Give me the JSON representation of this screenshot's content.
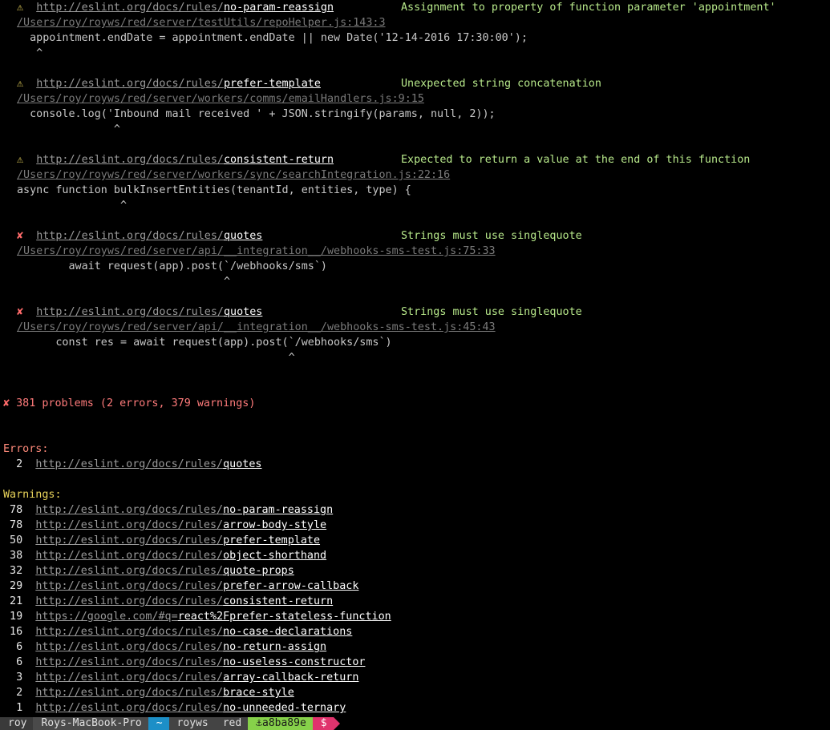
{
  "issues": [
    {
      "symbol": "⚠",
      "url_prefix": "http://eslint.org/docs/rules/",
      "rule": "no-param-reassign",
      "message": "Assignment to property of function parameter 'appointment'",
      "path": "/Users/roy/royws/red/server/testUtils/repoHelper.js:143:3",
      "code": "  appointment.endDate = appointment.endDate || new Date('12-14-2016 17:30:00');",
      "caret": "   ^"
    },
    {
      "symbol": "⚠",
      "url_prefix": "http://eslint.org/docs/rules/",
      "rule": "prefer-template",
      "message": "Unexpected string concatenation",
      "path": "/Users/roy/royws/red/server/workers/comms/emailHandlers.js:9:15",
      "code": "  console.log('Inbound mail received ' + JSON.stringify(params, null, 2));",
      "caret": "               ^"
    },
    {
      "symbol": "⚠",
      "url_prefix": "http://eslint.org/docs/rules/",
      "rule": "consistent-return",
      "message": "Expected to return a value at the end of this function",
      "path": "/Users/roy/royws/red/server/workers/sync/searchIntegration.js:22:16",
      "code": "async function bulkInsertEntities(tenantId, entities, type) {",
      "caret": "                ^"
    },
    {
      "symbol": "✘",
      "url_prefix": "http://eslint.org/docs/rules/",
      "rule": "quotes",
      "message": "Strings must use singlequote",
      "path": "/Users/roy/royws/red/server/api/__integration__/webhooks-sms-test.js:75:33",
      "code": "        await request(app).post(`/webhooks/sms`)",
      "caret": "                                ^"
    },
    {
      "symbol": "✘",
      "url_prefix": "http://eslint.org/docs/rules/",
      "rule": "quotes",
      "message": "Strings must use singlequote",
      "path": "/Users/roy/royws/red/server/api/__integration__/webhooks-sms-test.js:45:43",
      "code": "      const res = await request(app).post(`/webhooks/sms`)",
      "caret": "                                          ^"
    }
  ],
  "summary": {
    "symbol": "✘",
    "text": " 381 problems (2 errors, 379 warnings)"
  },
  "errors": {
    "heading": "Errors:",
    "items": [
      {
        "count": "  2",
        "url_prefix": "http://eslint.org/docs/rules/",
        "rule": "quotes"
      }
    ]
  },
  "warnings": {
    "heading": "Warnings:",
    "items": [
      {
        "count": " 78",
        "url_prefix": "http://eslint.org/docs/rules/",
        "rule": "no-param-reassign"
      },
      {
        "count": " 78",
        "url_prefix": "http://eslint.org/docs/rules/",
        "rule": "arrow-body-style"
      },
      {
        "count": " 50",
        "url_prefix": "http://eslint.org/docs/rules/",
        "rule": "prefer-template"
      },
      {
        "count": " 38",
        "url_prefix": "http://eslint.org/docs/rules/",
        "rule": "object-shorthand"
      },
      {
        "count": " 32",
        "url_prefix": "http://eslint.org/docs/rules/",
        "rule": "quote-props"
      },
      {
        "count": " 29",
        "url_prefix": "http://eslint.org/docs/rules/",
        "rule": "prefer-arrow-callback"
      },
      {
        "count": " 21",
        "url_prefix": "http://eslint.org/docs/rules/",
        "rule": "consistent-return"
      },
      {
        "count": " 19",
        "url_prefix": "https://google.com/#q=",
        "rule": "react%2Fprefer-stateless-function"
      },
      {
        "count": " 16",
        "url_prefix": "http://eslint.org/docs/rules/",
        "rule": "no-case-declarations"
      },
      {
        "count": "  6",
        "url_prefix": "http://eslint.org/docs/rules/",
        "rule": "no-return-assign"
      },
      {
        "count": "  6",
        "url_prefix": "http://eslint.org/docs/rules/",
        "rule": "no-useless-constructor"
      },
      {
        "count": "  3",
        "url_prefix": "http://eslint.org/docs/rules/",
        "rule": "array-callback-return"
      },
      {
        "count": "  2",
        "url_prefix": "http://eslint.org/docs/rules/",
        "rule": "brace-style"
      },
      {
        "count": "  1",
        "url_prefix": "http://eslint.org/docs/rules/",
        "rule": "no-unneeded-ternary"
      }
    ]
  },
  "prompt": {
    "user": "roy",
    "host": "Roys-MacBook-Pro",
    "home": "~",
    "dir1": "royws",
    "dir2": "red",
    "git": "⚓a8ba89e",
    "symbol": "$"
  }
}
